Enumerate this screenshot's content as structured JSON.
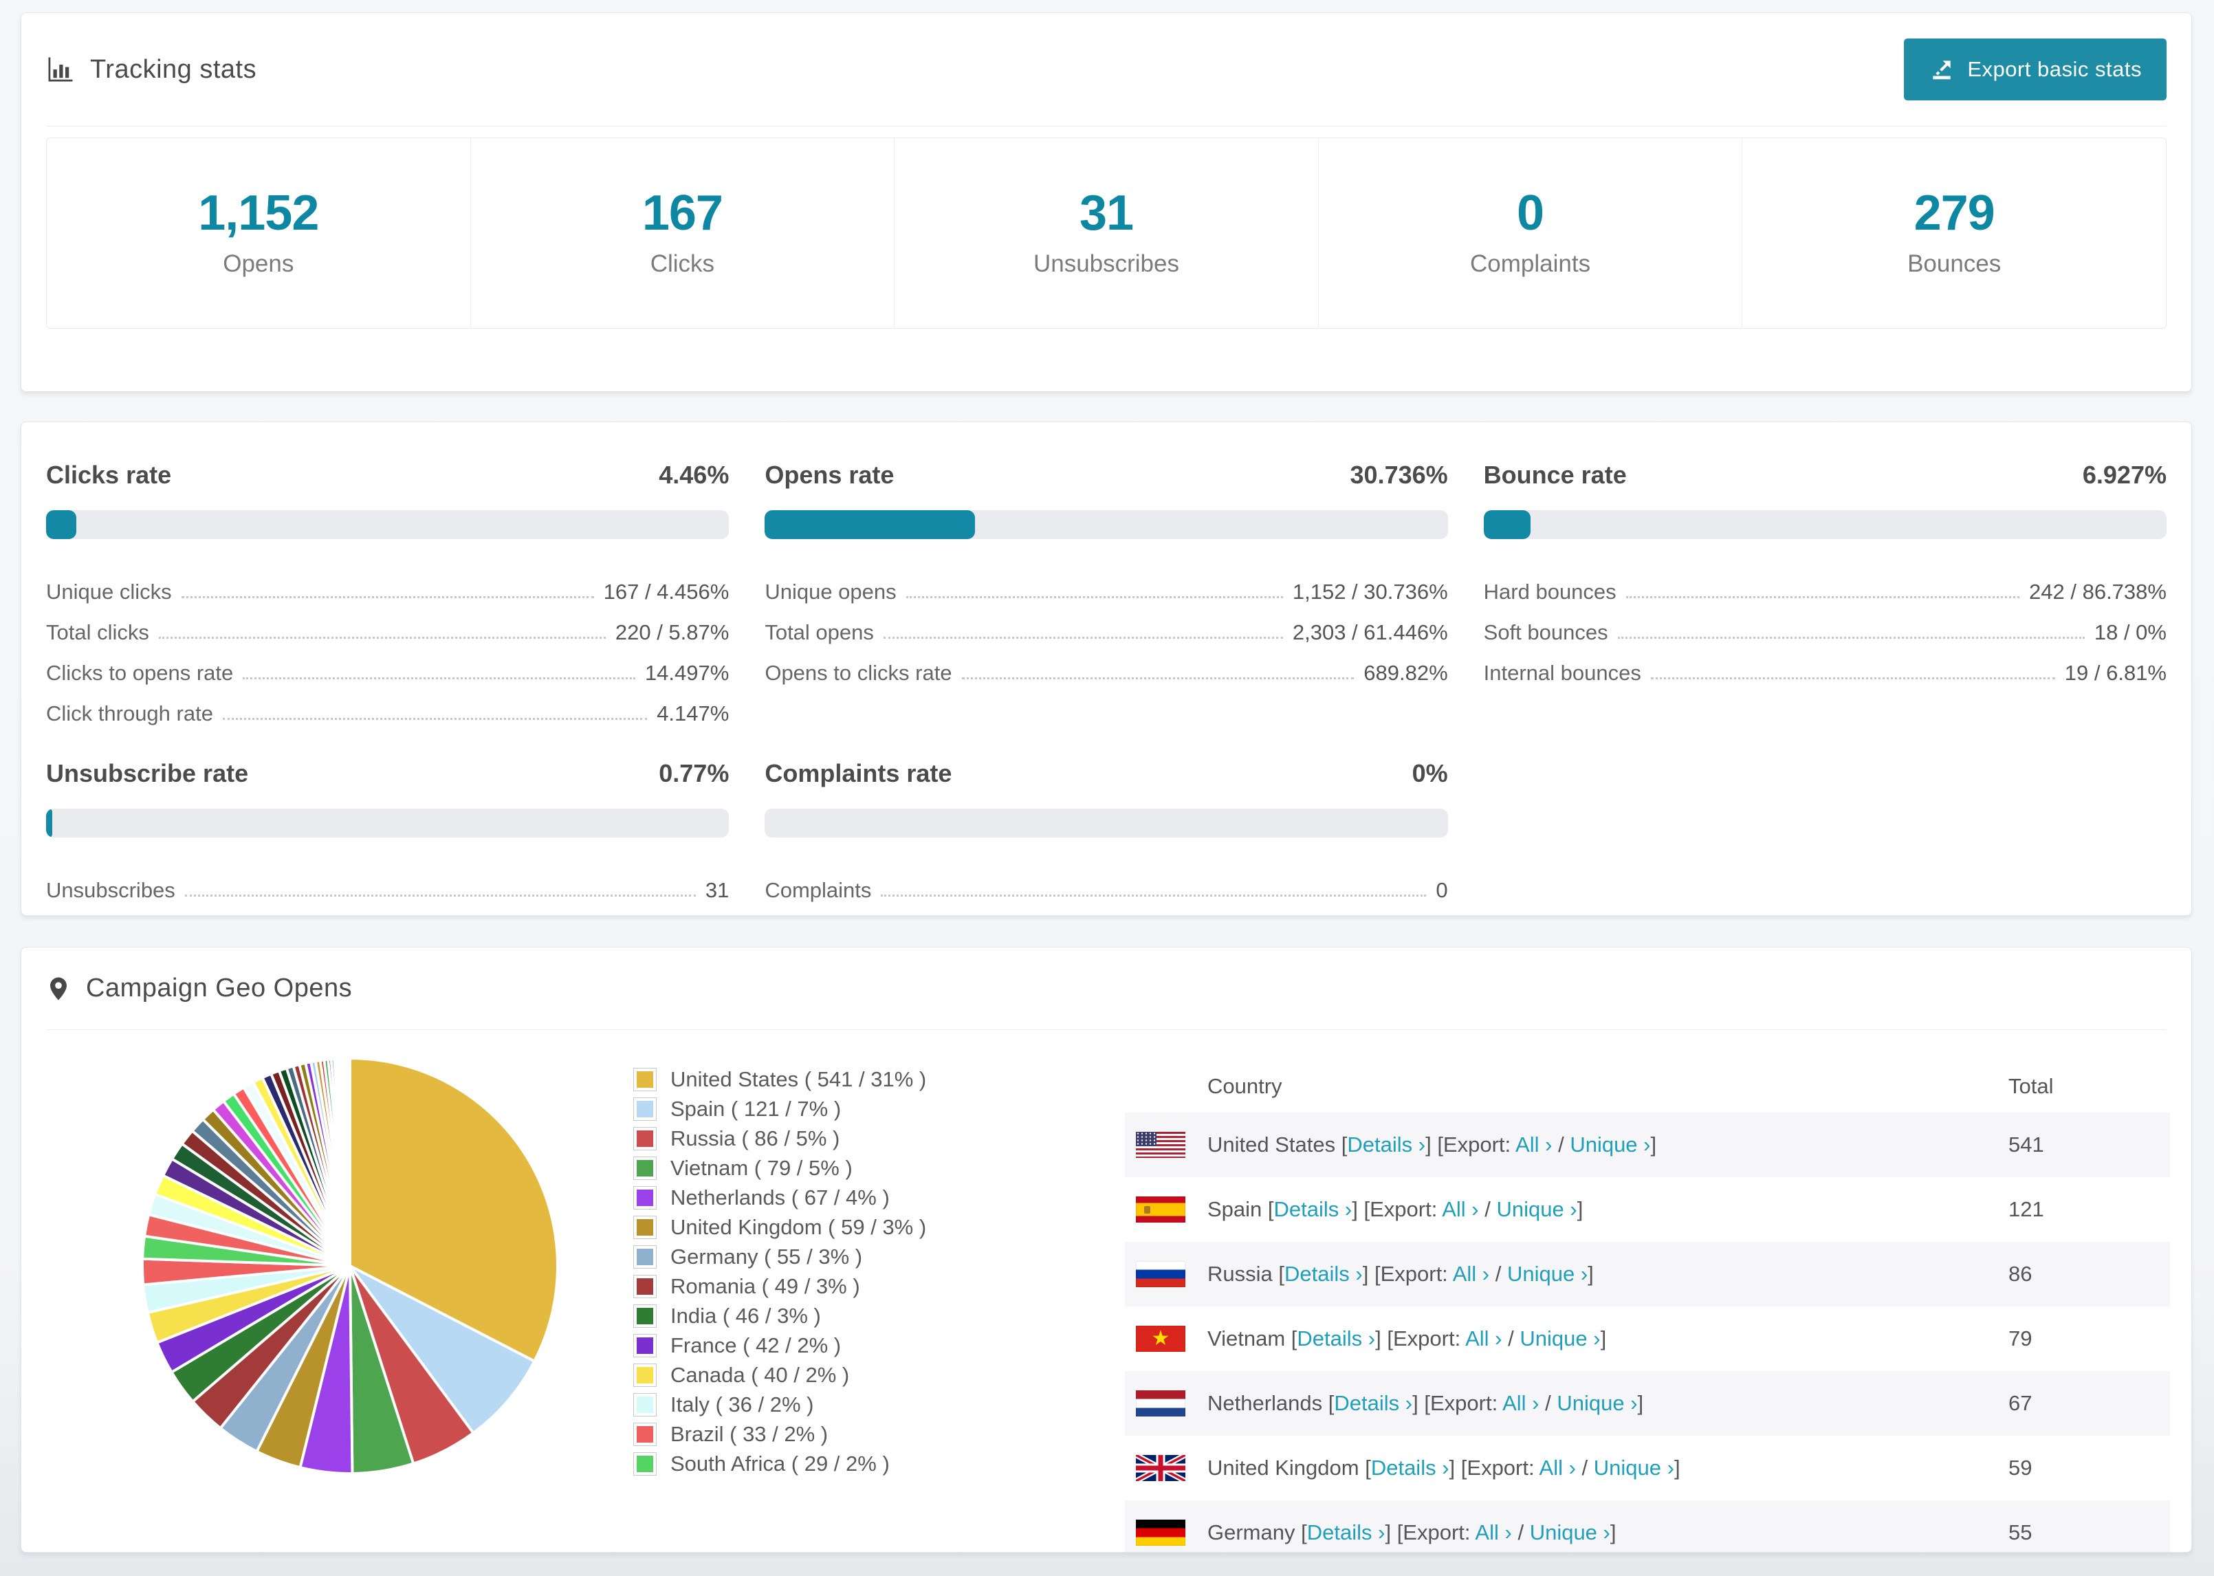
{
  "colors": {
    "accent": "#0e87a3",
    "button": "#1d8ca4",
    "link": "#1f9fba",
    "bar_track": "#e9ebee"
  },
  "tracking": {
    "title": "Tracking stats",
    "export_button": "Export basic stats",
    "summary": [
      {
        "value": "1,152",
        "label": "Opens"
      },
      {
        "value": "167",
        "label": "Clicks"
      },
      {
        "value": "31",
        "label": "Unsubscribes"
      },
      {
        "value": "0",
        "label": "Complaints"
      },
      {
        "value": "279",
        "label": "Bounces"
      }
    ]
  },
  "rates": {
    "clicks": {
      "title": "Clicks rate",
      "value": "4.46%",
      "bar_percent": 4.46,
      "rows": [
        {
          "label": "Unique clicks",
          "value": "167 / 4.456%"
        },
        {
          "label": "Total clicks",
          "value": "220 / 5.87%"
        },
        {
          "label": "Clicks to opens rate",
          "value": "14.497%"
        },
        {
          "label": "Click through rate",
          "value": "4.147%"
        }
      ]
    },
    "opens": {
      "title": "Opens rate",
      "value": "30.736%",
      "bar_percent": 30.736,
      "rows": [
        {
          "label": "Unique opens",
          "value": "1,152 / 30.736%"
        },
        {
          "label": "Total opens",
          "value": "2,303 / 61.446%"
        },
        {
          "label": "Opens to clicks rate",
          "value": "689.82%"
        }
      ]
    },
    "bounce": {
      "title": "Bounce rate",
      "value": "6.927%",
      "bar_percent": 6.927,
      "rows": [
        {
          "label": "Hard bounces",
          "value": "242 / 86.738%"
        },
        {
          "label": "Soft bounces",
          "value": "18 / 0%"
        },
        {
          "label": "Internal bounces",
          "value": "19 / 6.81%"
        }
      ]
    },
    "unsubscribe": {
      "title": "Unsubscribe rate",
      "value": "0.77%",
      "bar_percent": 0.77,
      "rows": [
        {
          "label": "Unsubscribes",
          "value": "31"
        }
      ]
    },
    "complaints": {
      "title": "Complaints rate",
      "value": "0%",
      "bar_percent": 0,
      "rows": [
        {
          "label": "Complaints",
          "value": "0"
        }
      ]
    }
  },
  "geo": {
    "title": "Campaign Geo Opens",
    "table": {
      "headers": {
        "country": "Country",
        "total": "Total"
      },
      "seg": {
        "lb": "[",
        "details": "Details ›",
        "rb": "]",
        "export": "[Export:",
        "all": "All ›",
        "slash": "/",
        "unique": "Unique ›"
      },
      "rows": [
        {
          "country": "United States",
          "total": "541"
        },
        {
          "country": "Spain",
          "total": "121"
        },
        {
          "country": "Russia",
          "total": "86"
        },
        {
          "country": "Vietnam",
          "total": "79"
        },
        {
          "country": "Netherlands",
          "total": "67"
        },
        {
          "country": "United Kingdom",
          "total": "59"
        },
        {
          "country": "Germany",
          "total": "55"
        }
      ]
    }
  },
  "chart_data": {
    "type": "pie",
    "title": "Campaign Geo Opens",
    "legend_position": "right",
    "start_angle_deg": -90,
    "direction": "clockwise",
    "slices": [
      {
        "label": "United States",
        "value": 541,
        "pct": "31%",
        "color": "#e3ba3f",
        "legend_label": "United States ( 541 / 31% )"
      },
      {
        "label": "Spain",
        "value": 121,
        "pct": "7%",
        "color": "#b8d9f3",
        "legend_label": "Spain ( 121 / 7% )"
      },
      {
        "label": "Russia",
        "value": 86,
        "pct": "5%",
        "color": "#cc4d4d",
        "legend_label": "Russia ( 86 / 5% )"
      },
      {
        "label": "Vietnam",
        "value": 79,
        "pct": "5%",
        "color": "#4da64f",
        "legend_label": "Vietnam ( 79 / 5% )"
      },
      {
        "label": "Netherlands",
        "value": 67,
        "pct": "4%",
        "color": "#9a41ea",
        "legend_label": "Netherlands ( 67 / 4% )"
      },
      {
        "label": "United Kingdom",
        "value": 59,
        "pct": "3%",
        "color": "#b8932b",
        "legend_label": "United Kingdom ( 59 / 3% )"
      },
      {
        "label": "Germany",
        "value": 55,
        "pct": "3%",
        "color": "#90b1ce",
        "legend_label": "Germany ( 55 / 3% )"
      },
      {
        "label": "Romania",
        "value": 49,
        "pct": "3%",
        "color": "#a33b3b",
        "legend_label": "Romania ( 49 / 3% )"
      },
      {
        "label": "India",
        "value": 46,
        "pct": "3%",
        "color": "#2e7d33",
        "legend_label": "India ( 46 / 3% )"
      },
      {
        "label": "France",
        "value": 42,
        "pct": "2%",
        "color": "#7a2fd0",
        "legend_label": "France ( 42 / 2% )"
      },
      {
        "label": "Canada",
        "value": 40,
        "pct": "2%",
        "color": "#f6e04b",
        "legend_label": "Canada ( 40 / 2% )"
      },
      {
        "label": "Italy",
        "value": 36,
        "pct": "2%",
        "color": "#d6f9fa",
        "legend_label": "Italy ( 36 / 2% )"
      },
      {
        "label": "Brazil",
        "value": 33,
        "pct": "2%",
        "color": "#ef5f5f",
        "legend_label": "Brazil ( 33 / 2% )"
      },
      {
        "label": "South Africa",
        "value": 29,
        "pct": "2%",
        "color": "#56d463",
        "legend_label": "South Africa ( 29 / 2% )"
      }
    ],
    "tail_values": [
      28,
      27,
      26,
      24,
      23,
      21,
      20,
      18,
      17,
      16,
      15,
      14,
      13,
      12,
      11,
      10,
      9,
      8,
      8,
      7,
      6,
      6,
      5,
      5,
      4,
      4,
      3,
      3,
      3,
      2,
      2,
      2,
      2,
      1,
      1,
      1
    ],
    "tail_colors": [
      "#f0625f",
      "#defbfb",
      "#ffff55",
      "#5b2d91",
      "#1d5e33",
      "#8b2e2e",
      "#5b7d96",
      "#9a7d1f",
      "#d24be0",
      "#44e06a",
      "#ff5c5c",
      "#eefcff",
      "#ffef55",
      "#2a2a6e",
      "#7a2020",
      "#0c4d22",
      "#4a6a85",
      "#a03333",
      "#8d7d14",
      "#8833dd",
      "#a6ccf2",
      "#cc9933",
      "#e03434",
      "#33a344",
      "#7722cc",
      "#2aa7a7",
      "#f066cc",
      "#6666ee",
      "#aaee66",
      "#ffaa33",
      "#cc66ff",
      "#3399ff",
      "#ff9999",
      "#66ddbb",
      "#9999ff",
      "#ffcc66"
    ]
  }
}
